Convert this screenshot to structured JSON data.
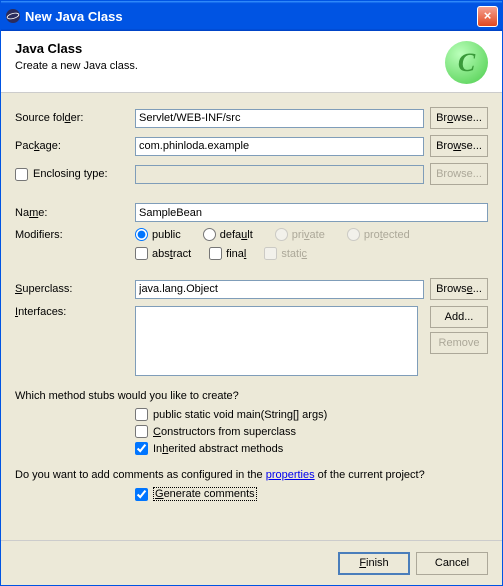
{
  "window": {
    "title": "New Java Class"
  },
  "header": {
    "title": "Java Class",
    "desc": "Create a new Java class."
  },
  "labels": {
    "sourceFolder": "Source folder:",
    "package": "Package:",
    "enclosingType": "Enclosing type:",
    "name": "Name:",
    "modifiers": "Modifiers:",
    "superclass": "Superclass:",
    "interfaces": "Interfaces:"
  },
  "values": {
    "sourceFolder": "Servlet/WEB-INF/src",
    "package": "com.phinloda.example",
    "enclosingType": "",
    "name": "SampleBean",
    "superclass": "java.lang.Object"
  },
  "buttons": {
    "browse": "Browse...",
    "add": "Add...",
    "remove": "Remove",
    "finish": "Finish",
    "cancel": "Cancel"
  },
  "modifiers": {
    "public": "public",
    "default": "default",
    "private": "private",
    "protected": "protected",
    "abstract": "abstract",
    "final": "final",
    "static": "static"
  },
  "stubs": {
    "question": "Which method stubs would you like to create?",
    "main": "public static void main(String[] args)",
    "constructors": "Constructors from superclass",
    "inherited": "Inherited abstract methods"
  },
  "comments": {
    "question_pre": "Do you want to add comments as configured in the ",
    "properties": "properties",
    "question_post": " of the current project?",
    "generate": "Generate comments"
  }
}
